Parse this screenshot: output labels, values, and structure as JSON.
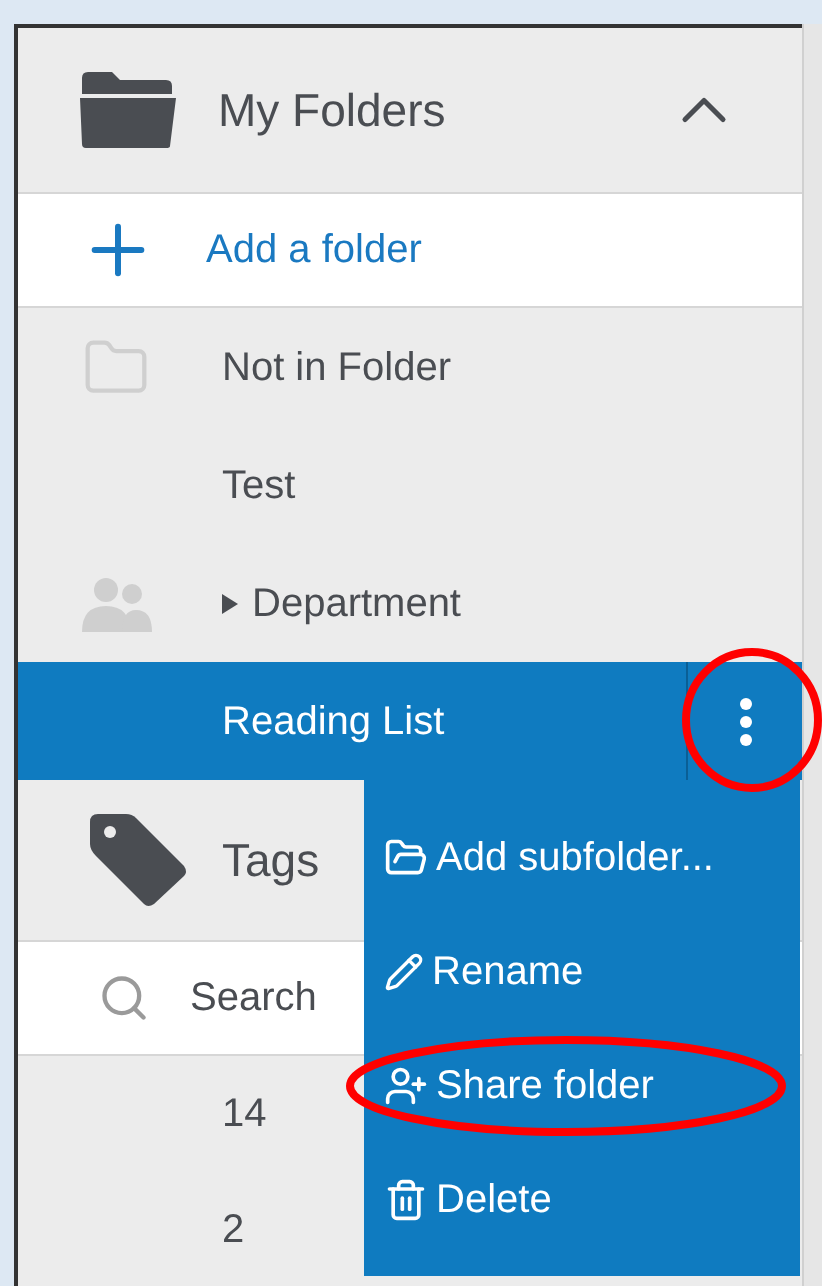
{
  "folders": {
    "title": "My Folders",
    "expanded": true,
    "add_label": "Add a folder",
    "items": [
      {
        "label": "Not in Folder",
        "kind": "empty-folder",
        "has_children": false,
        "selected": false,
        "circled": false
      },
      {
        "label": "Test",
        "kind": "plain",
        "has_children": false,
        "selected": false,
        "circled": false
      },
      {
        "label": "Department",
        "kind": "shared",
        "has_children": true,
        "selected": false,
        "circled": false
      },
      {
        "label": "Reading List",
        "kind": "plain",
        "has_children": false,
        "selected": true,
        "circled": true
      }
    ]
  },
  "tags": {
    "title": "Tags",
    "search": {
      "placeholder": "Search"
    },
    "items": [
      "14",
      "2"
    ]
  },
  "context_menu": {
    "items": [
      {
        "label": "Add subfolder...",
        "kind": "add-subfolder",
        "circled": false
      },
      {
        "label": "Rename",
        "kind": "rename",
        "circled": false
      },
      {
        "label": "Share folder",
        "kind": "share",
        "circled": true
      },
      {
        "label": "Delete",
        "kind": "delete",
        "circled": false
      }
    ]
  }
}
